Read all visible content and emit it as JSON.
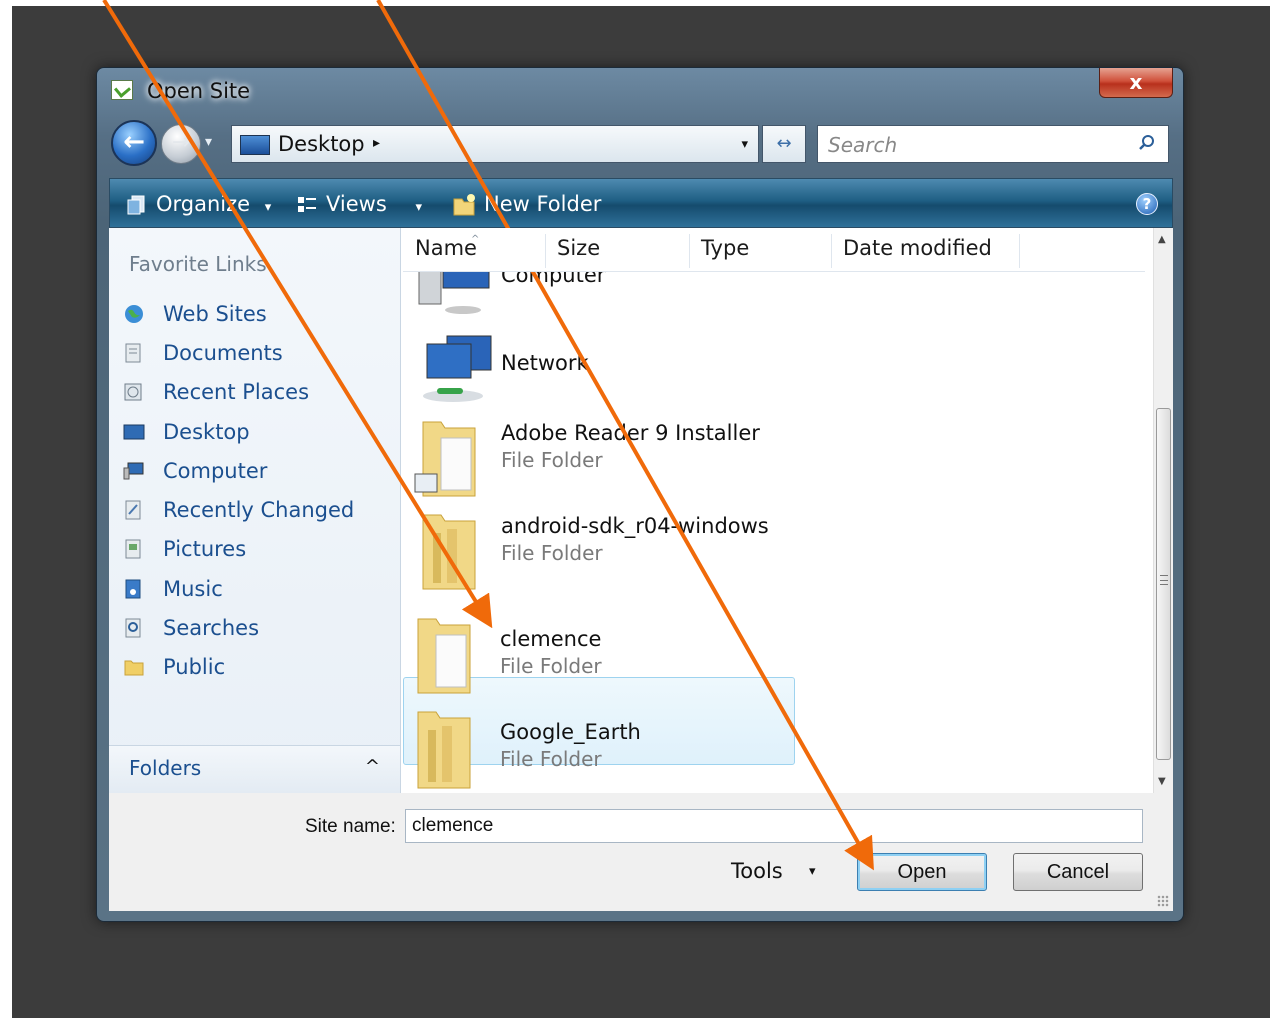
{
  "window": {
    "title": "Open Site",
    "close_label": "x"
  },
  "navigation": {
    "back_label": "←",
    "forward_label": "→",
    "history_dropdown": "▾",
    "address": "Desktop",
    "address_separator": "▸",
    "address_dropdown": "▾",
    "refresh_label": "↔",
    "search_placeholder": "Search"
  },
  "toolbar": {
    "organize_label": "Organize",
    "organize_drop": "▾",
    "views_label": "Views",
    "views_drop": "▾",
    "new_folder_label": "New Folder",
    "help_label": "?"
  },
  "sidebar": {
    "heading": "Favorite Links",
    "items": [
      {
        "label": "Web Sites",
        "icon": "globe-icon"
      },
      {
        "label": "Documents",
        "icon": "documents-icon"
      },
      {
        "label": "Recent Places",
        "icon": "recent-places-icon"
      },
      {
        "label": "Desktop",
        "icon": "desktop-icon"
      },
      {
        "label": "Computer",
        "icon": "computer-icon"
      },
      {
        "label": "Recently Changed",
        "icon": "recently-changed-icon"
      },
      {
        "label": "Pictures",
        "icon": "pictures-icon"
      },
      {
        "label": "Music",
        "icon": "music-icon"
      },
      {
        "label": "Searches",
        "icon": "searches-icon"
      },
      {
        "label": "Public",
        "icon": "public-icon"
      }
    ],
    "folders_label": "Folders",
    "folders_toggle": "^"
  },
  "file_list": {
    "columns": [
      "Name",
      "Size",
      "Type",
      "Date modified"
    ],
    "sort_indicator": "^",
    "items": [
      {
        "name": "Computer",
        "type": "",
        "icon": "computer-icon",
        "selected": false
      },
      {
        "name": "Network",
        "type": "",
        "icon": "network-icon",
        "selected": false
      },
      {
        "name": "Adobe Reader 9 Installer",
        "type": "File Folder",
        "icon": "folder-icon",
        "selected": false
      },
      {
        "name": "android-sdk_r04-windows",
        "type": "File Folder",
        "icon": "folder-icon",
        "selected": false
      },
      {
        "name": "clemence",
        "type": "File Folder",
        "icon": "folder-icon",
        "selected": true
      },
      {
        "name": "Google_Earth",
        "type": "File Folder",
        "icon": "folder-icon",
        "selected": false
      }
    ]
  },
  "footer": {
    "site_name_label": "Site name:",
    "site_name_value": "clemence",
    "tools_label": "Tools",
    "tools_drop": "▾",
    "open_label": "Open",
    "cancel_label": "Cancel"
  },
  "colors": {
    "annotation_arrow": "#f06a0a",
    "selection_fill": "#dff1fb",
    "toolbar": "#1f5f84",
    "link_text": "#1b4f8f"
  }
}
